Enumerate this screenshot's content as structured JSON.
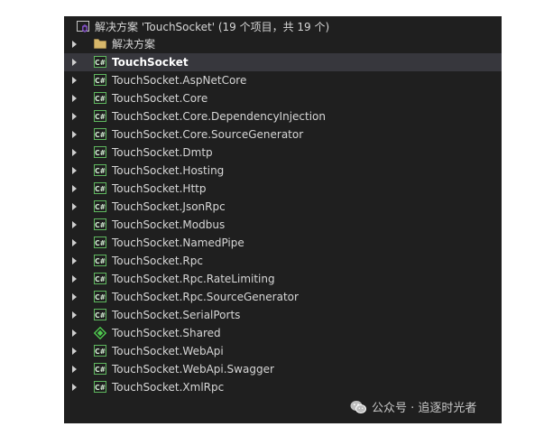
{
  "solution_header": {
    "title": "解决方案 'TouchSocket' (19 个项目，共 19 个)",
    "icon": "visual-studio-solution-icon"
  },
  "tree_items": [
    {
      "label": "解决方案",
      "icon": "folder-icon",
      "selected": false,
      "bold": false
    },
    {
      "label": "TouchSocket",
      "icon": "csharp-project-icon",
      "selected": true,
      "bold": true
    },
    {
      "label": "TouchSocket.AspNetCore",
      "icon": "csharp-project-icon",
      "selected": false,
      "bold": false
    },
    {
      "label": "TouchSocket.Core",
      "icon": "csharp-project-icon",
      "selected": false,
      "bold": false
    },
    {
      "label": "TouchSocket.Core.DependencyInjection",
      "icon": "csharp-project-icon",
      "selected": false,
      "bold": false
    },
    {
      "label": "TouchSocket.Core.SourceGenerator",
      "icon": "csharp-project-icon",
      "selected": false,
      "bold": false
    },
    {
      "label": "TouchSocket.Dmtp",
      "icon": "csharp-project-icon",
      "selected": false,
      "bold": false
    },
    {
      "label": "TouchSocket.Hosting",
      "icon": "csharp-project-icon",
      "selected": false,
      "bold": false
    },
    {
      "label": "TouchSocket.Http",
      "icon": "csharp-project-icon",
      "selected": false,
      "bold": false
    },
    {
      "label": "TouchSocket.JsonRpc",
      "icon": "csharp-project-icon",
      "selected": false,
      "bold": false
    },
    {
      "label": "TouchSocket.Modbus",
      "icon": "csharp-project-icon",
      "selected": false,
      "bold": false
    },
    {
      "label": "TouchSocket.NamedPipe",
      "icon": "csharp-project-icon",
      "selected": false,
      "bold": false
    },
    {
      "label": "TouchSocket.Rpc",
      "icon": "csharp-project-icon",
      "selected": false,
      "bold": false
    },
    {
      "label": "TouchSocket.Rpc.RateLimiting",
      "icon": "csharp-project-icon",
      "selected": false,
      "bold": false
    },
    {
      "label": "TouchSocket.Rpc.SourceGenerator",
      "icon": "csharp-project-icon",
      "selected": false,
      "bold": false
    },
    {
      "label": "TouchSocket.SerialPorts",
      "icon": "csharp-project-icon",
      "selected": false,
      "bold": false
    },
    {
      "label": "TouchSocket.Shared",
      "icon": "shared-project-icon",
      "selected": false,
      "bold": false
    },
    {
      "label": "TouchSocket.WebApi",
      "icon": "csharp-project-icon",
      "selected": false,
      "bold": false
    },
    {
      "label": "TouchSocket.WebApi.Swagger",
      "icon": "csharp-project-icon",
      "selected": false,
      "bold": false
    },
    {
      "label": "TouchSocket.XmlRpc",
      "icon": "csharp-project-icon",
      "selected": false,
      "bold": false
    }
  ],
  "watermark": {
    "text": "公众号 · 追逐时光者",
    "icon": "wechat-icon"
  },
  "colors": {
    "panel_bg": "#1f1f1f",
    "selected_bg": "#37373d",
    "csharp_icon": "#4ec94e",
    "folder_icon": "#d7b76a",
    "solution_icon": "#b180d7"
  }
}
